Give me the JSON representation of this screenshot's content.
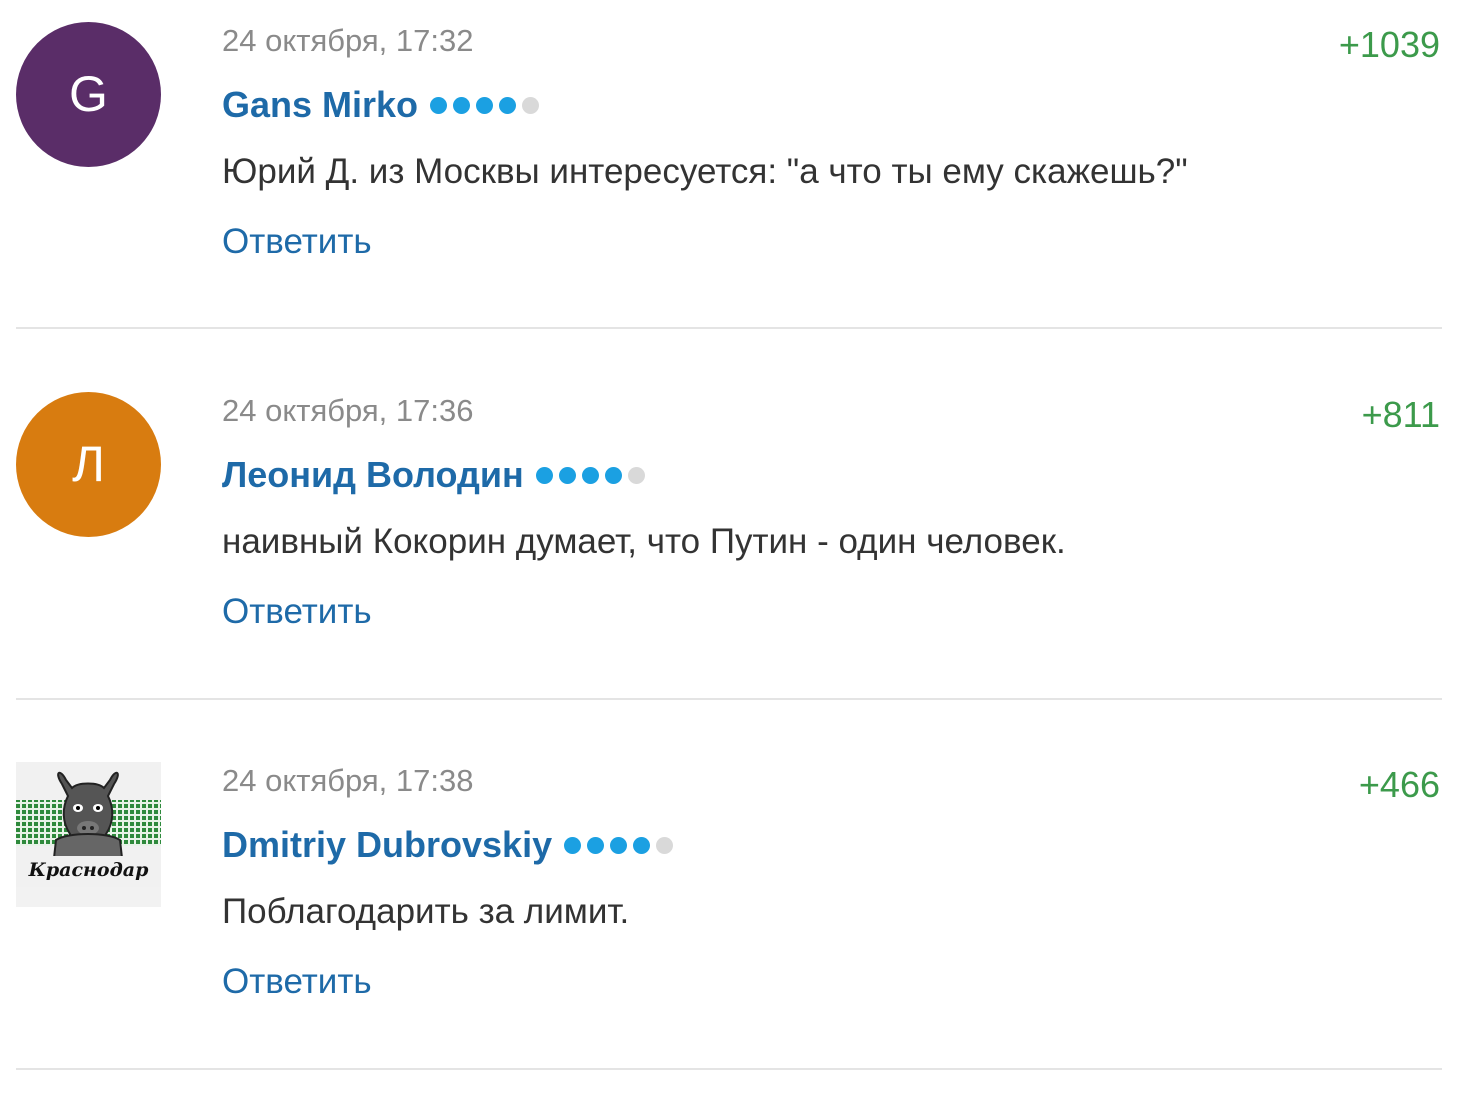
{
  "comments": [
    {
      "avatar_letter": "G",
      "avatar_color": "#5a2d68",
      "date": "24 октября, 17:32",
      "author": "Gans Mirko",
      "rank_dots_filled": 4,
      "rank_dots_total": 5,
      "text": "Юрий Д. из Москвы интересуется: \"а что ты ему скажешь?\"",
      "rating": "+1039",
      "reply_label": "Ответить"
    },
    {
      "avatar_letter": "Л",
      "avatar_color": "#d87c10",
      "date": "24 октября, 17:36",
      "author": "Леонид Володин",
      "rank_dots_filled": 4,
      "rank_dots_total": 5,
      "text": "наивный Кокорин думает, что Путин - один человек.",
      "rating": "+811",
      "reply_label": "Ответить"
    },
    {
      "avatar_image": "krasnodar-bull-logo",
      "avatar_logo_text": "Краснодар",
      "date": "24 октября, 17:38",
      "author": "Dmitriy Dubrovskiy",
      "rank_dots_filled": 4,
      "rank_dots_total": 5,
      "text": "Поблагодарить за лимит.",
      "rating": "+466",
      "reply_label": "Ответить"
    }
  ],
  "colors": {
    "author_link": "#1e6aa8",
    "rating_positive": "#3c9a4b",
    "rank_dot": "#1ba0e2",
    "rank_dot_off": "#d9d9d9",
    "divider": "#e4e4e4"
  }
}
